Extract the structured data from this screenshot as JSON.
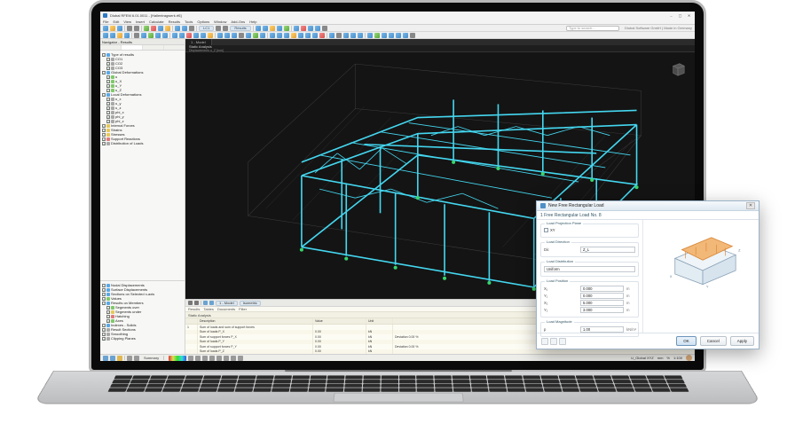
{
  "app": {
    "title": "Dlubal RFEM 6.01.0011 - [Hallentragwerk.rf6]",
    "brand": "Dlubal Software GmbH | Made in Germany"
  },
  "menu": [
    "File",
    "Edit",
    "View",
    "Insert",
    "Calculate",
    "Results",
    "Tools",
    "Options",
    "Window",
    "Add-Ons",
    "Help"
  ],
  "search": {
    "placeholder": "Type to search..."
  },
  "navigator": {
    "title": "Navigator - Results",
    "tree": [
      {
        "lvl": 0,
        "ic": "b",
        "t": "Type of results"
      },
      {
        "lvl": 1,
        "ic": "gy",
        "t": "CO1"
      },
      {
        "lvl": 1,
        "ic": "gy",
        "t": "CO2"
      },
      {
        "lvl": 1,
        "ic": "gy",
        "t": "CO3"
      },
      {
        "lvl": 0,
        "ic": "b",
        "t": "Global Deformations"
      },
      {
        "lvl": 1,
        "ic": "gr",
        "t": "u"
      },
      {
        "lvl": 1,
        "ic": "gr",
        "t": "u_X"
      },
      {
        "lvl": 1,
        "ic": "gr",
        "t": "u_Y"
      },
      {
        "lvl": 1,
        "ic": "gr",
        "t": "u_Z"
      },
      {
        "lvl": 0,
        "ic": "b",
        "t": "Local Deformations"
      },
      {
        "lvl": 1,
        "ic": "gy",
        "t": "u_x"
      },
      {
        "lvl": 1,
        "ic": "gy",
        "t": "u_y"
      },
      {
        "lvl": 1,
        "ic": "gy",
        "t": "u_z"
      },
      {
        "lvl": 1,
        "ic": "gy",
        "t": "phi_x"
      },
      {
        "lvl": 1,
        "ic": "gy",
        "t": "phi_y"
      },
      {
        "lvl": 1,
        "ic": "gy",
        "t": "phi_z"
      },
      {
        "lvl": 0,
        "ic": "ye",
        "t": "Internal Forces"
      },
      {
        "lvl": 0,
        "ic": "ye",
        "t": "Strains"
      },
      {
        "lvl": 0,
        "ic": "ye",
        "t": "Stresses"
      },
      {
        "lvl": 0,
        "ic": "rd",
        "t": "Support Reactions"
      },
      {
        "lvl": 0,
        "ic": "gy",
        "t": "Distribution of Loads"
      }
    ],
    "tree2": [
      {
        "lvl": 0,
        "ic": "b",
        "t": "Nodal Displacements"
      },
      {
        "lvl": 0,
        "ic": "b",
        "t": "Surface Displacements"
      },
      {
        "lvl": 0,
        "ic": "b",
        "t": "Sections on Selected x-axis"
      },
      {
        "lvl": 0,
        "ic": "gr",
        "t": "Values"
      },
      {
        "lvl": 0,
        "ic": "b",
        "t": "Results on Members"
      },
      {
        "lvl": 1,
        "ic": "gr",
        "t": "Segments over"
      },
      {
        "lvl": 1,
        "ic": "ye",
        "t": "Segments under"
      },
      {
        "lvl": 1,
        "ic": "rd",
        "t": "Hatching"
      },
      {
        "lvl": 1,
        "ic": "gr",
        "t": "Axes"
      },
      {
        "lvl": 0,
        "ic": "b",
        "t": "Indexes - Solids"
      },
      {
        "lvl": 0,
        "ic": "gy",
        "t": "Result Sections"
      },
      {
        "lvl": 0,
        "ic": "gy",
        "t": "Smoothing"
      },
      {
        "lvl": 0,
        "ic": "gy",
        "t": "Clipping Planes"
      }
    ]
  },
  "viewport": {
    "tab": "1 - Model",
    "heading": "Static Analysis",
    "subheading": "Displacements u_Z [mm]",
    "secondTab": "1 - Model",
    "secondPill": "Isometric"
  },
  "dataPanel": {
    "tabs": [
      "Results",
      "Tables",
      "Documents",
      "Filter"
    ],
    "title": "Static Analysis",
    "cols": [
      "",
      "Description",
      "Value",
      "Unit",
      ""
    ],
    "rows": [
      [
        "1",
        "Sum of loads and sum of support forces",
        "",
        "",
        ""
      ],
      [
        "",
        "Sum of loads P_X",
        "0.00",
        "kN",
        ""
      ],
      [
        "",
        "Sum of support forces P_X",
        "0.00",
        "kN",
        "Deviation 0.00 %"
      ],
      [
        "",
        "Sum of loads P_Y",
        "0.00",
        "kN",
        ""
      ],
      [
        "",
        "Sum of support forces P_Y",
        "0.00",
        "kN",
        "Deviation 0.00 %"
      ],
      [
        "",
        "Sum of loads P_Z",
        "0.00",
        "kN",
        ""
      ],
      [
        "",
        "Sum of support forces P_Z",
        "0.00",
        "kN",
        ""
      ]
    ]
  },
  "statusbar": {
    "right": [
      "U_Global XYZ",
      "mm",
      "%",
      "1:100"
    ],
    "summary": "Summary"
  },
  "dialog": {
    "title": "New Free Rectangular Load",
    "tab": "1  Free Rectangular Load No. 8",
    "sections": {
      "projection": "Load Projection Plane",
      "direction": "Load Direction",
      "distribution": "Load Distribution",
      "position": "Load Position",
      "magnitude": "Load Magnitude"
    },
    "fields": {
      "projPlane": "XY",
      "direction": "Z_L",
      "distribution": "Uniform",
      "x1": "0.000",
      "y1": "0.000",
      "x2": "5.000",
      "y2": "3.000",
      "p": "1.00"
    },
    "units": {
      "len": "m",
      "press": "kN/m²"
    },
    "buttons": {
      "ok": "OK",
      "cancel": "Cancel",
      "apply": "Apply"
    }
  }
}
